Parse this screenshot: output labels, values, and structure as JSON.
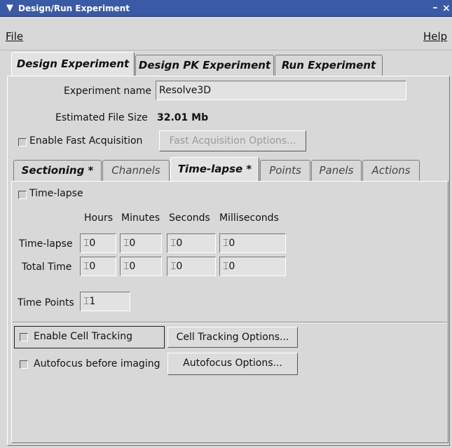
{
  "window": {
    "title": "Design/Run Experiment"
  },
  "menu": {
    "file": "File",
    "help": "Help"
  },
  "main_tabs": [
    "Design Experiment",
    "Design PK Experiment",
    "Run Experiment"
  ],
  "experiment": {
    "name_label": "Experiment name",
    "name_value": "Resolve3D",
    "size_label": "Estimated File Size",
    "size_value": "32.01 Mb",
    "fast_acq_label": "Enable Fast Acquisition",
    "fast_acq_button": "Fast Acquisition Options..."
  },
  "sub_tabs": [
    "Sectioning *",
    "Channels",
    "Time-lapse *",
    "Points",
    "Panels",
    "Actions"
  ],
  "timelapse": {
    "checkbox_label": "Time-lapse",
    "headers": [
      "Hours",
      "Minutes",
      "Seconds",
      "Milliseconds"
    ],
    "rows": [
      {
        "label": "Time-lapse",
        "values": [
          "0",
          "0",
          "0",
          "0"
        ]
      },
      {
        "label": "Total Time",
        "values": [
          "0",
          "0",
          "0",
          "0"
        ]
      }
    ],
    "points_label": "Time Points",
    "points_value": "1"
  },
  "tracking": {
    "cell_tracking_label": "Enable Cell Tracking",
    "cell_tracking_button": "Cell Tracking Options...",
    "autofocus_label": "Autofocus before imaging",
    "autofocus_button": "Autofocus Options..."
  }
}
